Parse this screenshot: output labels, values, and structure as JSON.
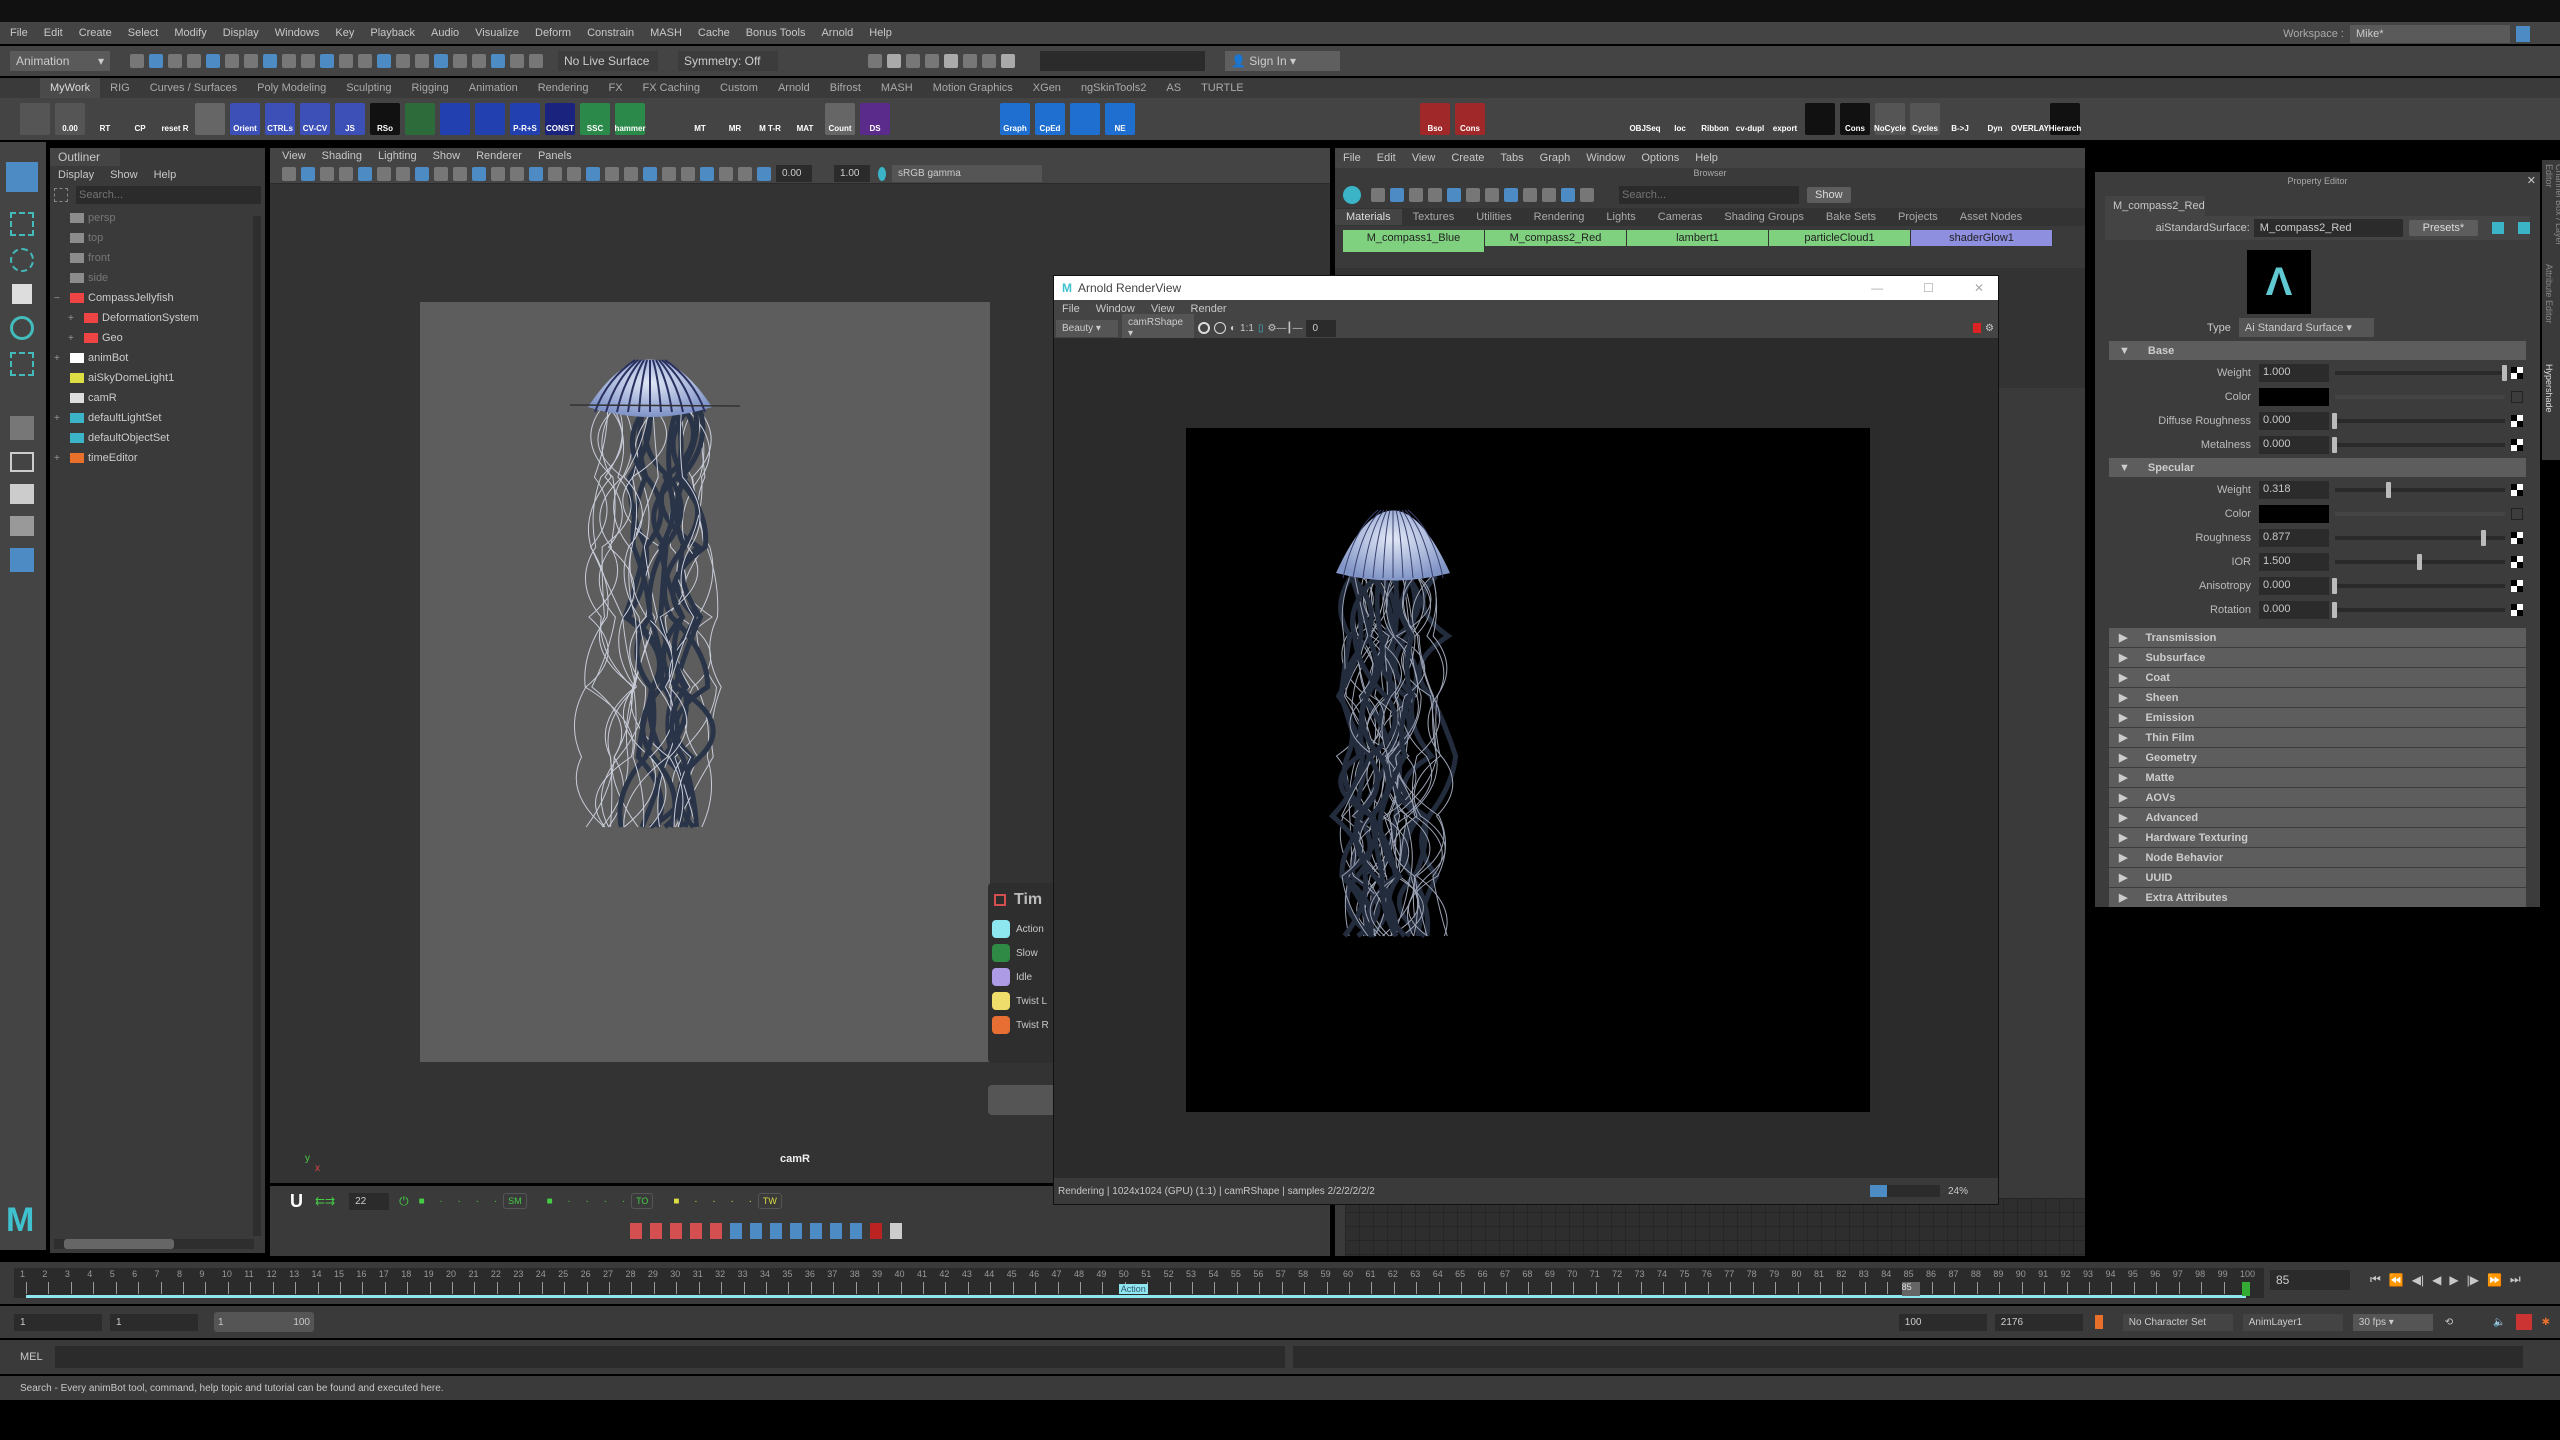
{
  "menubar": {
    "items": [
      "File",
      "Edit",
      "Create",
      "Select",
      "Modify",
      "Display",
      "Windows",
      "Key",
      "Playback",
      "Audio",
      "Visualize",
      "Deform",
      "Constrain",
      "MASH",
      "Cache",
      "Bonus Tools",
      "Arnold",
      "Help"
    ],
    "workspace_label": "Workspace :",
    "workspace_value": "Mike*"
  },
  "statusline": {
    "mode": "Animation",
    "live_surface": "No Live Surface",
    "symmetry": "Symmetry: Off",
    "sign_in": "Sign In"
  },
  "shelf": {
    "tabs": [
      "MyWork",
      "RIG",
      "Curves / Surfaces",
      "Poly Modeling",
      "Sculpting",
      "Rigging",
      "Animation",
      "Rendering",
      "FX",
      "FX Caching",
      "Custom",
      "Arnold",
      "Bifrost",
      "MASH",
      "Motion Graphics",
      "XGen",
      "ngSkinTools2",
      "AS",
      "TURTLE"
    ],
    "active_tab": "MyWork",
    "buttons": [
      {
        "l": "",
        "c": "#555"
      },
      {
        "l": "0.00",
        "c": "#555"
      },
      {
        "l": "RT",
        "c": "#444"
      },
      {
        "l": "CP",
        "c": "#444"
      },
      {
        "l": "reset R",
        "c": "#444"
      },
      {
        "l": "",
        "c": "#666"
      },
      {
        "l": "Orient",
        "c": "#3d50b8"
      },
      {
        "l": "CTRLs",
        "c": "#3d50b8"
      },
      {
        "l": "CV-CV",
        "c": "#3d50b8"
      },
      {
        "l": "JS",
        "c": "#3d50b8"
      },
      {
        "l": "RSo",
        "c": "#111"
      },
      {
        "l": "",
        "c": "#2d6b3a"
      },
      {
        "l": "",
        "c": "#2340b0"
      },
      {
        "l": "",
        "c": "#2340b0"
      },
      {
        "l": "P-R+S",
        "c": "#2340b0"
      },
      {
        "l": "CONST",
        "c": "#1a237e"
      },
      {
        "l": "SSC",
        "c": "#2b8a4a"
      },
      {
        "l": "hammer",
        "c": "#2b8a4a"
      },
      {
        "l": "",
        "c": "#444"
      },
      {
        "l": "MT",
        "c": "#444"
      },
      {
        "l": "MR",
        "c": "#444"
      },
      {
        "l": "M T-R",
        "c": "#444"
      },
      {
        "l": "MAT",
        "c": "#444"
      },
      {
        "l": "Count",
        "c": "#666"
      },
      {
        "l": "DS",
        "c": "#5a2b8a"
      },
      {
        "l": "",
        "c": "#444"
      },
      {
        "l": "",
        "c": "#444"
      },
      {
        "l": "",
        "c": "#444"
      },
      {
        "l": "Graph",
        "c": "#1e6fd0"
      },
      {
        "l": "CpEd",
        "c": "#1e6fd0"
      },
      {
        "l": "",
        "c": "#1e6fd0"
      },
      {
        "l": "NE",
        "c": "#1e6fd0"
      },
      {
        "l": "",
        "c": "#444"
      },
      {
        "l": "",
        "c": "#444"
      },
      {
        "l": "",
        "c": "#444"
      },
      {
        "l": "",
        "c": "#444"
      },
      {
        "l": "",
        "c": "#444"
      },
      {
        "l": "",
        "c": "#444"
      },
      {
        "l": "",
        "c": "#444"
      },
      {
        "l": "",
        "c": "#444"
      },
      {
        "l": "Bso",
        "c": "#a02828"
      },
      {
        "l": "Cons",
        "c": "#a02828"
      },
      {
        "l": "",
        "c": "#444"
      },
      {
        "l": "",
        "c": "#444"
      },
      {
        "l": "",
        "c": "#444"
      },
      {
        "l": "",
        "c": "#444"
      },
      {
        "l": "OBJSeq",
        "c": "#444"
      },
      {
        "l": "loc",
        "c": "#444"
      },
      {
        "l": "Ribbon",
        "c": "#444"
      },
      {
        "l": "cv-dupl",
        "c": "#444"
      },
      {
        "l": "export",
        "c": "#444"
      },
      {
        "l": "",
        "c": "#111"
      },
      {
        "l": "Cons",
        "c": "#111"
      },
      {
        "l": "NoCycle",
        "c": "#555"
      },
      {
        "l": "Cycles",
        "c": "#555"
      },
      {
        "l": "B->J",
        "c": "#444"
      },
      {
        "l": "Dyn",
        "c": "#444"
      },
      {
        "l": "OVERLAY",
        "c": "#444"
      },
      {
        "l": "Hierarch",
        "c": "#111"
      }
    ]
  },
  "outliner": {
    "title": "Outliner",
    "menu": [
      "Display",
      "Show",
      "Help"
    ],
    "search_placeholder": "Search...",
    "items": [
      {
        "label": "persp",
        "indent": 0,
        "dim": true,
        "icon": "camera"
      },
      {
        "label": "top",
        "indent": 0,
        "dim": true,
        "icon": "camera"
      },
      {
        "label": "front",
        "indent": 0,
        "dim": true,
        "icon": "camera"
      },
      {
        "label": "side",
        "indent": 0,
        "dim": true,
        "icon": "camera"
      },
      {
        "label": "CompassJellyfish",
        "indent": 0,
        "exp": "−",
        "icon": "group"
      },
      {
        "label": "DeformationSystem",
        "indent": 1,
        "exp": "+",
        "icon": "group"
      },
      {
        "label": "Geo",
        "indent": 1,
        "exp": "+",
        "icon": "group"
      },
      {
        "label": "animBot",
        "indent": 0,
        "exp": "+",
        "icon": "animbot"
      },
      {
        "label": "aiSkyDomeLight1",
        "indent": 0,
        "icon": "light"
      },
      {
        "label": "camR",
        "indent": 0,
        "icon": "camera"
      },
      {
        "label": "defaultLightSet",
        "indent": 0,
        "exp": "+",
        "icon": "set"
      },
      {
        "label": "defaultObjectSet",
        "indent": 0,
        "icon": "set"
      },
      {
        "label": "timeEditor",
        "indent": 0,
        "exp": "+",
        "icon": "time"
      }
    ]
  },
  "viewport": {
    "menu": [
      "View",
      "Shading",
      "Lighting",
      "Show",
      "Renderer",
      "Panels"
    ],
    "exposure": "0.00",
    "gamma": "1.00",
    "colorspace": "sRGB gamma",
    "camera_label": "camR",
    "axis_y": "y",
    "axis_x": "x"
  },
  "time_editor_popup": {
    "title": "Tim",
    "items": [
      {
        "label": "Action",
        "color": "#8ee6ef"
      },
      {
        "label": "Slow",
        "color": "#2f8a45"
      },
      {
        "label": "Idle",
        "color": "#ad9be6"
      },
      {
        "label": "Twist L",
        "color": "#eedd6a"
      },
      {
        "label": "Twist R",
        "color": "#e86f33"
      }
    ]
  },
  "animbot_bar": {
    "frame": "22",
    "markers": [
      "SM",
      "TO",
      "TW"
    ]
  },
  "renderview": {
    "title": "Arnold RenderView",
    "menu": [
      "File",
      "Window",
      "View",
      "Render"
    ],
    "aov": "Beauty",
    "camera": "camRShape",
    "ratio": "1:1",
    "exposure": "0",
    "status": "Rendering | 1024x1024 (GPU) (1:1) | camRShape | samples 2/2/2/2/2/2",
    "progress_label": "24%",
    "progress": 0.24
  },
  "hypershade": {
    "menu": [
      "File",
      "Edit",
      "View",
      "Create",
      "Tabs",
      "Graph",
      "Window",
      "Options",
      "Help"
    ],
    "browser_label": "Browser",
    "search_placeholder": "Search...",
    "show_button": "Show",
    "tabs": [
      "Materials",
      "Textures",
      "Utilities",
      "Rendering",
      "Lights",
      "Cameras",
      "Shading Groups",
      "Bake Sets",
      "Projects",
      "Asset Nodes"
    ],
    "materials": [
      {
        "name": "M_compass1_Blue",
        "color": "#7fd17f"
      },
      {
        "name": "M_compass2_Red",
        "color": "#7fd17f"
      },
      {
        "name": "lambert1",
        "color": "#7fd17f"
      },
      {
        "name": "particleCloud1",
        "color": "#7fd17f"
      },
      {
        "name": "shaderGlow1",
        "color": "#8f8fe0"
      }
    ]
  },
  "property_editor": {
    "title": "Property Editor",
    "tab": "M_compass2_Red",
    "node_type_label": "aiStandardSurface:",
    "node_name": "M_compass2_Red",
    "presets": "Presets*",
    "type_label": "Type",
    "type_value": "Ai Standard Surface",
    "base": {
      "title": "Base",
      "rows": [
        {
          "label": "Weight",
          "value": "1.000",
          "slider": 1.0
        },
        {
          "label": "Color",
          "color": "#000000"
        },
        {
          "label": "Diffuse Roughness",
          "value": "0.000",
          "slider": 0
        },
        {
          "label": "Metalness",
          "value": "0.000",
          "slider": 0
        }
      ]
    },
    "specular": {
      "title": "Specular",
      "rows": [
        {
          "label": "Weight",
          "value": "0.318",
          "slider": 0.318
        },
        {
          "label": "Color",
          "color": "#000000"
        },
        {
          "label": "Roughness",
          "value": "0.877",
          "slider": 0.877
        },
        {
          "label": "IOR",
          "value": "1.500",
          "slider": 0.5
        },
        {
          "label": "Anisotropy",
          "value": "0.000",
          "slider": 0
        },
        {
          "label": "Rotation",
          "value": "0.000",
          "slider": 0
        }
      ]
    },
    "collapsed": [
      "Transmission",
      "Subsurface",
      "Coat",
      "Sheen",
      "Emission",
      "Thin Film",
      "Geometry",
      "Matte",
      "AOVs",
      "Advanced",
      "Hardware Texturing",
      "Node Behavior",
      "UUID",
      "Extra Attributes"
    ]
  },
  "side_tabs": [
    "Channel Box / Layer Editor",
    "Attribute Editor",
    "Hypershade"
  ],
  "timeline": {
    "start": 1,
    "end": 100,
    "current": "85",
    "clip_label": "Action",
    "current_field": "85"
  },
  "range": {
    "start": "1",
    "anim_start": "1",
    "range_min": "1",
    "range_max": "100",
    "end": "100",
    "anim_end": "2176",
    "character_set": "No Character Set",
    "anim_layer": "AnimLayer1",
    "fps": "30 fps"
  },
  "mel": {
    "label": "MEL"
  },
  "helpline": "Search - Every animBot tool, command, help topic and tutorial can be found and executed here."
}
